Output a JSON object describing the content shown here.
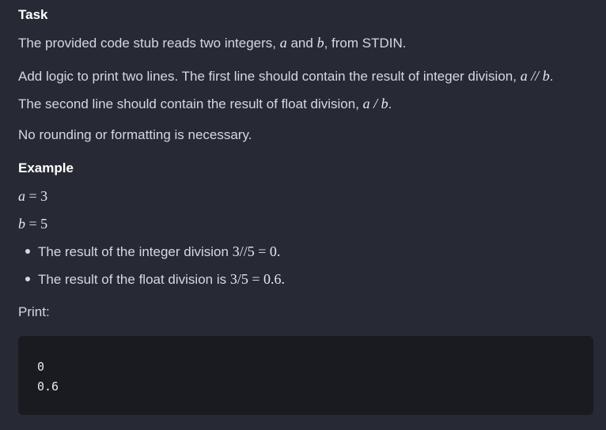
{
  "task": {
    "heading": "Task",
    "p1_before": "The provided code stub reads two integers, ",
    "var_a": "a",
    "p1_and": " and ",
    "var_b": "b",
    "p1_after": ", from STDIN.",
    "p2_before": "Add logic to print two lines. The first line should contain the result of integer division, ",
    "p2_op": " // ",
    "p2_end": ".",
    "p3_before": "The second line should contain the result of float division, ",
    "p3_op": " / ",
    "p3_end": ".",
    "p4": "No rounding or formatting is necessary."
  },
  "example": {
    "heading": "Example",
    "a_line": "a",
    "a_value": " = 3",
    "b_line": "b",
    "b_value": " = 5",
    "bullet1_text": "The result of the integer division ",
    "bullet1_math": "3//5 = 0.",
    "bullet2_text": "The result of the float division is ",
    "bullet2_math": "3/5 = 0.6."
  },
  "print": {
    "label": "Print:",
    "output_lines": [
      "0",
      "0.6"
    ]
  }
}
